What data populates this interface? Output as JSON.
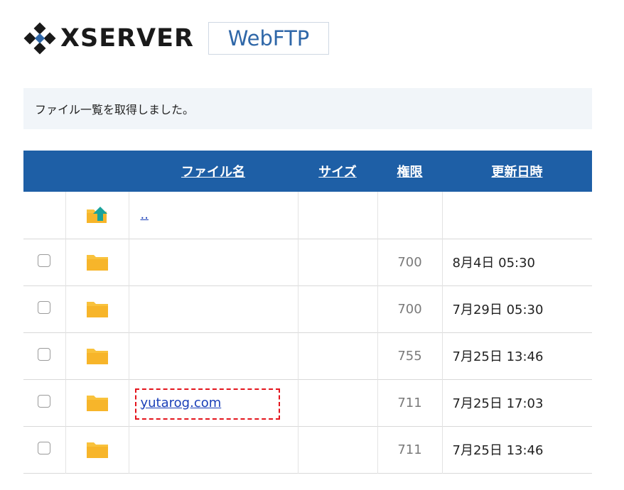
{
  "header": {
    "logo_text": "XSERVER",
    "app_name": "WebFTP"
  },
  "message": "ファイル一覧を取得しました。",
  "table": {
    "columns": {
      "name": "ファイル名",
      "size": "サイズ",
      "permission": "権限",
      "modified": "更新日時"
    },
    "parent_link": "..",
    "rows": [
      {
        "name": "",
        "size": "",
        "permission": "700",
        "modified": "8月4日 05:30"
      },
      {
        "name": "",
        "size": "",
        "permission": "700",
        "modified": "7月29日 05:30"
      },
      {
        "name": "",
        "size": "",
        "permission": "755",
        "modified": "7月25日 13:46"
      },
      {
        "name": "yutarog.com",
        "size": "",
        "permission": "711",
        "modified": "7月25日 17:03"
      },
      {
        "name": "",
        "size": "",
        "permission": "711",
        "modified": "7月25日 13:46"
      }
    ]
  },
  "icons": {
    "folder": "folder-icon",
    "parent_folder": "folder-up-icon",
    "logo": "xserver-logo-icon"
  },
  "colors": {
    "header_bg": "#1e5fa6",
    "folder": "#f9c23c",
    "up_arrow": "#1aa39b",
    "link": "#1a3fb8",
    "highlight": "#e4141c"
  }
}
